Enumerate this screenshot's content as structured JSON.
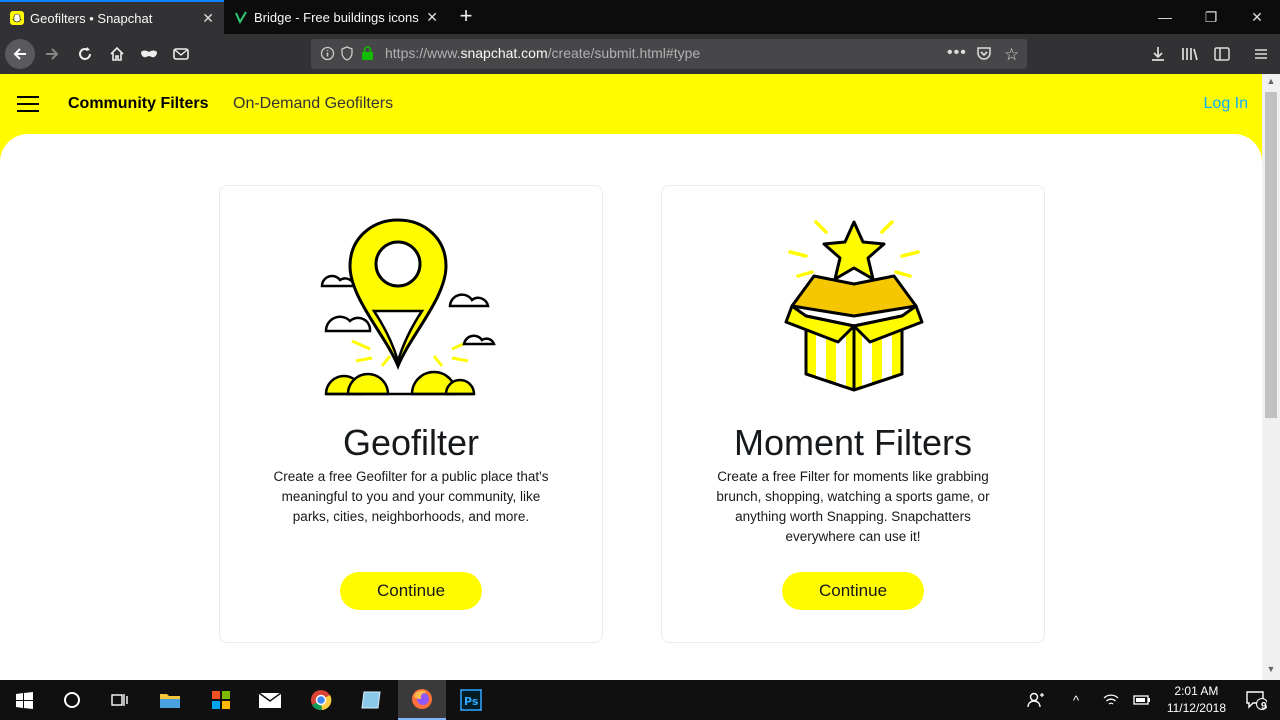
{
  "browser": {
    "tabs": [
      {
        "title": "Geofilters • Snapchat",
        "active": true
      },
      {
        "title": "Bridge - Free buildings icons",
        "active": false
      }
    ],
    "url_prefix": "https://www.",
    "url_domain": "snapchat.com",
    "url_path": "/create/submit.html#type"
  },
  "header": {
    "nav_primary": "Community Filters",
    "nav_secondary": "On-Demand Geofilters",
    "login": "Log In"
  },
  "cards": [
    {
      "title": "Geofilter",
      "description": "Create a free Geofilter for a public place that's meaningful to you and your community, like parks, cities, neighborhoods, and more.",
      "button": "Continue"
    },
    {
      "title": "Moment Filters",
      "description": "Create a free Filter for moments like grabbing brunch, shopping, watching a sports game, or anything worth Snapping. Snapchatters everywhere can use it!",
      "button": "Continue"
    }
  ],
  "taskbar": {
    "time": "2:01 AM",
    "date": "11/12/2018",
    "notification_count": "9"
  },
  "colors": {
    "snap_yellow": "#FFFC00",
    "login_blue": "#0FADFF",
    "browser_dark": "#323234",
    "tabbar_dark": "#0C0C0D",
    "taskbar": "#101010"
  }
}
